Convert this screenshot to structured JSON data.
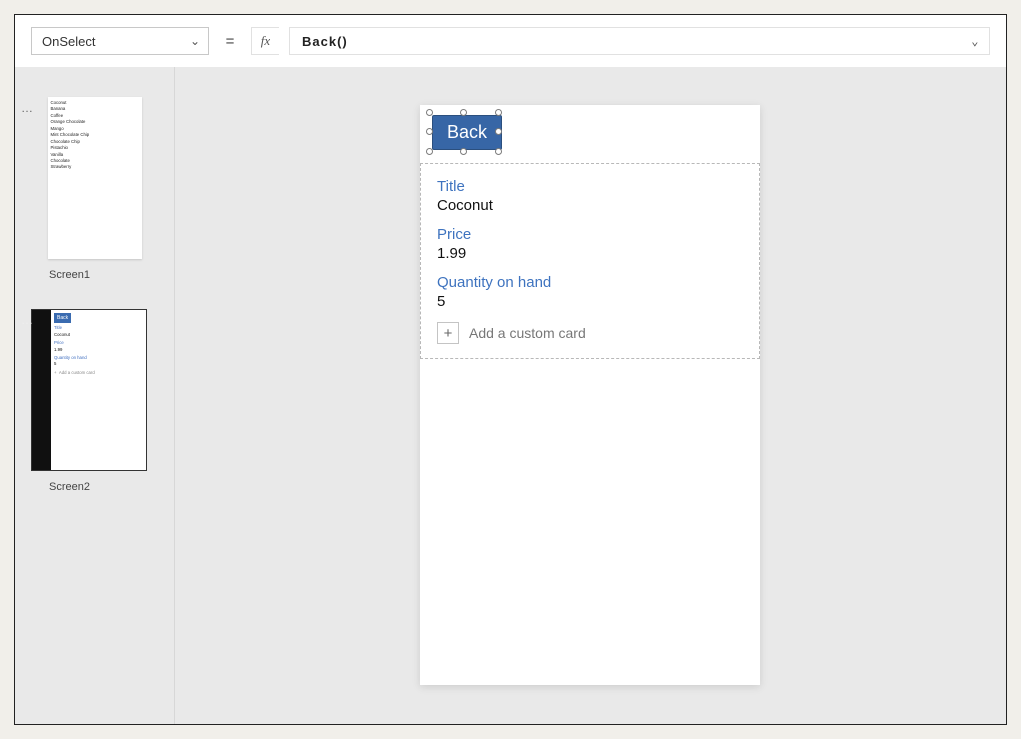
{
  "formula_bar": {
    "property": "OnSelect",
    "equals": "=",
    "fx": "fx",
    "value": "Back()"
  },
  "thumbs": {
    "screen1": {
      "label": "Screen1",
      "items": [
        "Coconut",
        "Banana",
        "Coffee",
        "Orange Chocolate",
        "Mango",
        "Mint Chocolate Chip",
        "Chocolate Chip",
        "Pistachio",
        "Vanilla",
        "Chocolate",
        "Strawberry"
      ]
    },
    "screen2": {
      "label": "Screen2",
      "back": "Back",
      "fields": {
        "title_label": "Title",
        "title_value": "Coconut",
        "price_label": "Price",
        "price_value": "1.99",
        "qty_label": "Quantity on hand",
        "qty_value": "5"
      },
      "add_custom": "Add a custom card"
    }
  },
  "canvas": {
    "back_button": "Back",
    "fields": {
      "title_label": "Title",
      "title_value": "Coconut",
      "price_label": "Price",
      "price_value": "1.99",
      "qty_label": "Quantity on hand",
      "qty_value": "5"
    },
    "add_custom": "Add a custom card"
  }
}
